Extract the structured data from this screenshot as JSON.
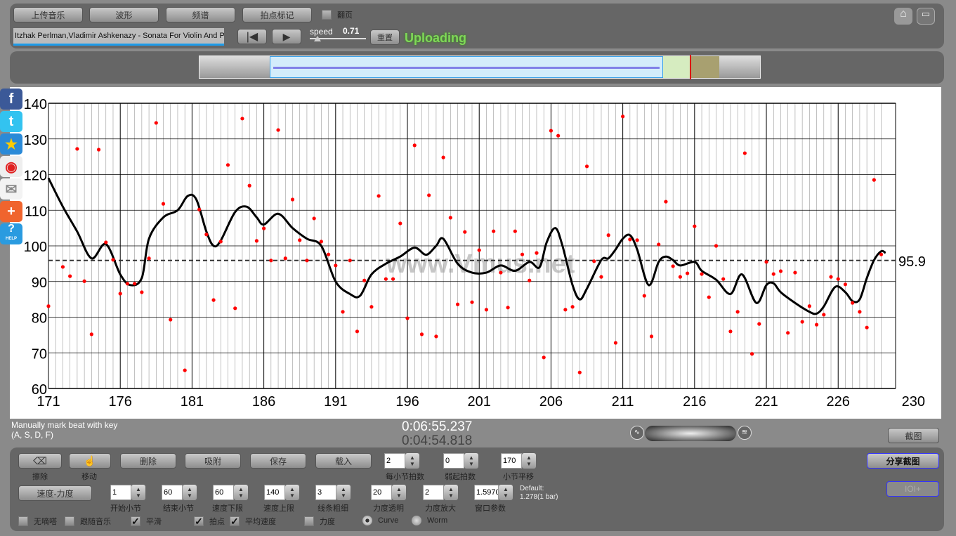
{
  "toolbar": {
    "upload": "上传音乐",
    "waveform": "波形",
    "spectrum": "频谱",
    "beat_mark": "拍点标记",
    "page_turn": "翻页",
    "track_title": "Itzhak Perlman,Vladimir Ashkenazy - Sonata For Violin And Piano",
    "speed_label": "speed",
    "speed_value": "0.71",
    "reset": "重置",
    "status": "Uploading",
    "status_color": "#7ed957"
  },
  "icons": [
    "home-icon",
    "fullscreen-icon",
    "facebook-icon",
    "twitter-icon",
    "favorite-star-icon",
    "weibo-icon",
    "mail-icon",
    "plus-icon",
    "help-icon"
  ],
  "help_label": "HELP",
  "watermark": "www.Vmus.net",
  "info": {
    "hint_line1": "Manually mark beat with key",
    "hint_line2": "(A, S, D, F)",
    "time_total": "0:06:55.237",
    "time_current": "0:04:54.818",
    "screenshot": "截图",
    "share_screenshot": "分享截图",
    "ioi_button": "IOI+"
  },
  "controls": {
    "erase": "擦除",
    "move": "移动",
    "delete": "删除",
    "snap": "吸附",
    "save": "保存",
    "load": "载入",
    "beats_per_bar": {
      "value": "2",
      "label": "每小节拍数"
    },
    "pickup_beats": {
      "value": "0",
      "label": "弱起拍数"
    },
    "bar_offset": {
      "value": "170",
      "label": "小节平移"
    },
    "tempo_dynamics": "速度-力度",
    "start_bar": {
      "value": "1",
      "label": "开始小节"
    },
    "end_bar": {
      "value": "60",
      "label": "结束小节"
    },
    "tempo_min": {
      "value": "60",
      "label": "速度下限"
    },
    "tempo_max": {
      "value": "140",
      "label": "速度上限"
    },
    "line_width": {
      "value": "3",
      "label": "线条粗细"
    },
    "dyn_opacity": {
      "value": "20",
      "label": "力度透明"
    },
    "dyn_scale": {
      "value": "2",
      "label": "力度放大"
    },
    "window_param": {
      "value": "1.59700",
      "label": "窗口参数"
    },
    "default_line1": "Default:",
    "default_line2": "1.278(1 bar)",
    "checks": [
      {
        "label": "无嘀嗒",
        "checked": false
      },
      {
        "label": "跟随音乐",
        "checked": false
      },
      {
        "label": "平滑",
        "checked": true
      },
      {
        "label": "拍点",
        "checked": true
      },
      {
        "label": "平均速度",
        "checked": true
      },
      {
        "label": "力度",
        "checked": false
      }
    ],
    "radios": [
      {
        "label": "Curve",
        "selected": true
      },
      {
        "label": "Worm",
        "selected": false
      }
    ]
  },
  "chart_data": {
    "type": "scatter+line",
    "xlim": [
      171,
      230
    ],
    "ylim": [
      60,
      140
    ],
    "xticks": [
      171,
      176,
      181,
      186,
      191,
      196,
      201,
      206,
      211,
      216,
      221,
      226,
      230
    ],
    "yticks": [
      60,
      70,
      80,
      90,
      100,
      110,
      120,
      130,
      140
    ],
    "grid": true,
    "mean_tempo": 95.9,
    "mean_label": "95.9",
    "points": [
      [
        171,
        83.1
      ],
      [
        172,
        94.1
      ],
      [
        172.5,
        91.5
      ],
      [
        173,
        127.2
      ],
      [
        173.5,
        90.1
      ],
      [
        174,
        75.2
      ],
      [
        174.5,
        127
      ],
      [
        175,
        101
      ],
      [
        175.5,
        96.1
      ],
      [
        176,
        86.6
      ],
      [
        176.5,
        89.4
      ],
      [
        177,
        89.4
      ],
      [
        177.5,
        87
      ],
      [
        178,
        96.5
      ],
      [
        178.5,
        134.5
      ],
      [
        179,
        111.8
      ],
      [
        179.5,
        79.3
      ],
      [
        180.5,
        65.1
      ],
      [
        181.5,
        110.2
      ],
      [
        182,
        103.2
      ],
      [
        182.5,
        84.8
      ],
      [
        183,
        101.2
      ],
      [
        183.5,
        122.7
      ],
      [
        184,
        82.5
      ],
      [
        184.5,
        135.7
      ],
      [
        185,
        116.9
      ],
      [
        185.5,
        101.4
      ],
      [
        186,
        104.9
      ],
      [
        186.5,
        95.9
      ],
      [
        187,
        132.5
      ],
      [
        187.5,
        96.5
      ],
      [
        188,
        113
      ],
      [
        188.5,
        101.6
      ],
      [
        189,
        95.9
      ],
      [
        189.5,
        107.7
      ],
      [
        190,
        101.2
      ],
      [
        190.5,
        97.6
      ],
      [
        191,
        94.5
      ],
      [
        191.5,
        81.5
      ],
      [
        192,
        95.9
      ],
      [
        192.5,
        76
      ],
      [
        193,
        90.3
      ],
      [
        193.5,
        82.9
      ],
      [
        194,
        114
      ],
      [
        194.5,
        90.7
      ],
      [
        195,
        90.7
      ],
      [
        195.5,
        106.3
      ],
      [
        196,
        79.7
      ],
      [
        196.5,
        128.2
      ],
      [
        197,
        75.2
      ],
      [
        197.5,
        114.2
      ],
      [
        198,
        74.6
      ],
      [
        198.5,
        124.8
      ],
      [
        199,
        107.9
      ],
      [
        199.5,
        83.6
      ],
      [
        200,
        103.9
      ],
      [
        200.5,
        84.2
      ],
      [
        201,
        98.8
      ],
      [
        201.5,
        82.1
      ],
      [
        202,
        104.1
      ],
      [
        202.5,
        92.5
      ],
      [
        203,
        82.7
      ],
      [
        203.5,
        104.1
      ],
      [
        204,
        97.6
      ],
      [
        204.5,
        90.3
      ],
      [
        205,
        98
      ],
      [
        205.5,
        68.7
      ],
      [
        206,
        132.3
      ],
      [
        206.5,
        130.9
      ],
      [
        207,
        82.1
      ],
      [
        207.5,
        82.9
      ],
      [
        208,
        64.5
      ],
      [
        208.5,
        122.3
      ],
      [
        209,
        95.7
      ],
      [
        209.5,
        91.3
      ],
      [
        210,
        103
      ],
      [
        210.5,
        72.8
      ],
      [
        211,
        136.3
      ],
      [
        211.5,
        101.8
      ],
      [
        212,
        101.6
      ],
      [
        212.5,
        86
      ],
      [
        213,
        74.6
      ],
      [
        213.5,
        100.4
      ],
      [
        214,
        112.4
      ],
      [
        214.5,
        94.3
      ],
      [
        215,
        91.3
      ],
      [
        215.5,
        92.3
      ],
      [
        216,
        105.5
      ],
      [
        216.5,
        92.1
      ],
      [
        217,
        85.6
      ],
      [
        217.5,
        100
      ],
      [
        218,
        90.7
      ],
      [
        218.5,
        76
      ],
      [
        219,
        81.5
      ],
      [
        219.5,
        126
      ],
      [
        220,
        69.7
      ],
      [
        220.5,
        78.1
      ],
      [
        221,
        95.5
      ],
      [
        221.5,
        92.1
      ],
      [
        222,
        92.9
      ],
      [
        222.5,
        75.6
      ],
      [
        223,
        92.5
      ],
      [
        223.5,
        78.7
      ],
      [
        224,
        83.1
      ],
      [
        224.5,
        77.9
      ],
      [
        225,
        80.7
      ],
      [
        225.5,
        91.3
      ],
      [
        226,
        90.7
      ],
      [
        226.5,
        89.2
      ],
      [
        227,
        84
      ],
      [
        227.5,
        81.5
      ],
      [
        228,
        77.1
      ],
      [
        228.5,
        118.5
      ],
      [
        229,
        97.6
      ]
    ],
    "curve": [
      [
        171,
        119
      ],
      [
        172,
        111
      ],
      [
        173,
        104
      ],
      [
        174,
        96.5
      ],
      [
        175,
        100.5
      ],
      [
        176,
        92
      ],
      [
        176.7,
        89
      ],
      [
        177.5,
        91
      ],
      [
        178,
        102
      ],
      [
        179,
        108
      ],
      [
        180,
        110
      ],
      [
        180.7,
        114
      ],
      [
        181.3,
        113
      ],
      [
        182,
        104
      ],
      [
        182.5,
        100
      ],
      [
        183,
        101.5
      ],
      [
        184,
        109.5
      ],
      [
        184.8,
        111
      ],
      [
        185.5,
        108
      ],
      [
        186,
        106
      ],
      [
        187,
        109
      ],
      [
        188,
        105
      ],
      [
        189,
        102
      ],
      [
        190,
        100
      ],
      [
        191,
        90
      ],
      [
        192,
        86.5
      ],
      [
        192.7,
        86
      ],
      [
        193.5,
        92
      ],
      [
        194.5,
        95
      ],
      [
        195.5,
        97
      ],
      [
        196.5,
        99.5
      ],
      [
        197.3,
        97.5
      ],
      [
        198,
        100
      ],
      [
        198.5,
        102
      ],
      [
        199.5,
        95
      ],
      [
        200.5,
        92.5
      ],
      [
        201.5,
        92.5
      ],
      [
        202.5,
        94.5
      ],
      [
        203.5,
        93
      ],
      [
        204.5,
        95.5
      ],
      [
        205.2,
        94
      ],
      [
        205.7,
        101
      ],
      [
        206.3,
        105
      ],
      [
        206.8,
        100
      ],
      [
        207.5,
        89
      ],
      [
        208,
        85
      ],
      [
        208.5,
        88
      ],
      [
        209.5,
        96
      ],
      [
        210,
        96.5
      ],
      [
        210.5,
        99
      ],
      [
        211,
        102
      ],
      [
        211.5,
        103
      ],
      [
        212,
        99
      ],
      [
        212.8,
        89
      ],
      [
        213.5,
        95.5
      ],
      [
        214,
        97
      ],
      [
        214.5,
        96
      ],
      [
        215,
        94.5
      ],
      [
        216,
        95.5
      ],
      [
        216.5,
        93
      ],
      [
        217.5,
        90.5
      ],
      [
        218.5,
        86.5
      ],
      [
        219.3,
        92
      ],
      [
        220.3,
        84
      ],
      [
        221,
        89
      ],
      [
        221.5,
        89.5
      ],
      [
        222,
        87
      ],
      [
        223,
        84
      ],
      [
        224,
        81.5
      ],
      [
        224.5,
        81
      ],
      [
        225,
        83
      ],
      [
        225.8,
        88.5
      ],
      [
        226.5,
        87
      ],
      [
        227,
        84.5
      ],
      [
        227.5,
        85
      ],
      [
        228,
        91
      ],
      [
        228.5,
        96
      ],
      [
        229,
        98.5
      ],
      [
        229.3,
        98
      ]
    ],
    "point_color": "#ff0000",
    "curve_color": "#000000"
  }
}
